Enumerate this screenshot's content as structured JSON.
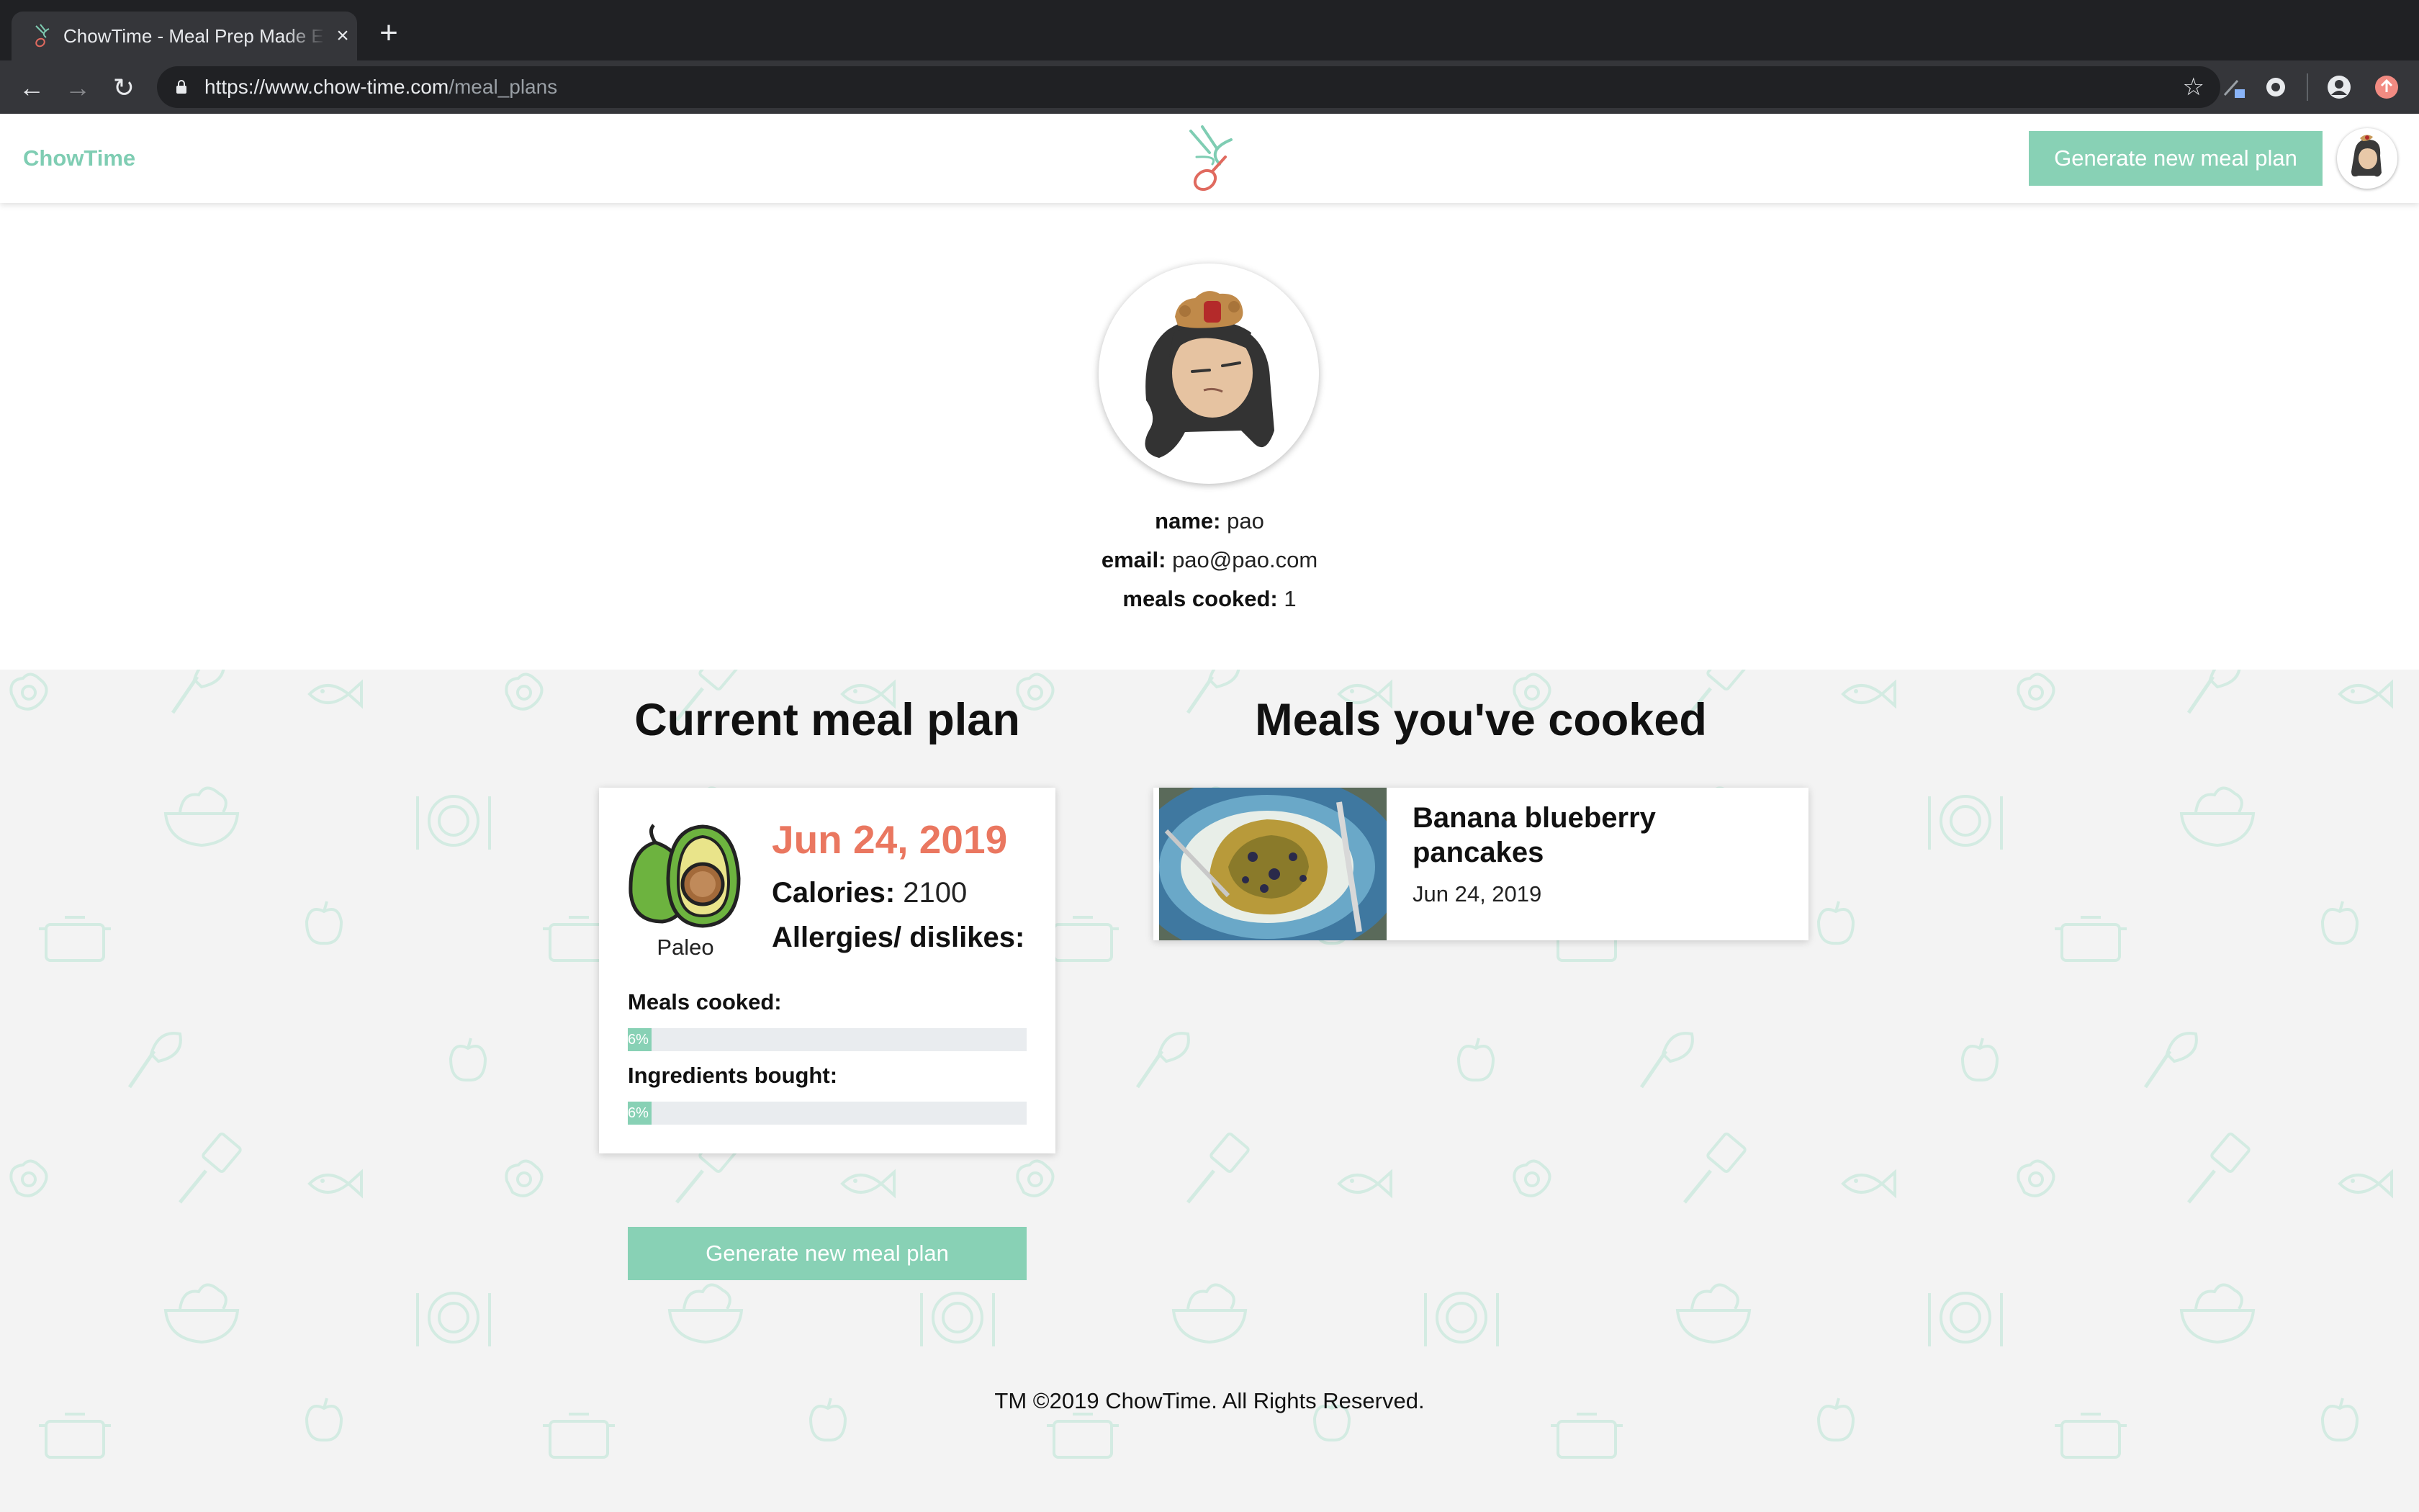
{
  "browser": {
    "tab_title": "ChowTime - Meal Prep Made E",
    "url_host": "https://www.chow-time.com",
    "url_path": "/meal_plans"
  },
  "header": {
    "brand": "ChowTime",
    "generate_button": "Generate new meal plan"
  },
  "profile": {
    "name_label": "name:",
    "name_value": " pao",
    "email_label": "email:",
    "email_value": " pao@pao.com",
    "meals_label": "meals cooked:",
    "meals_value": " 1"
  },
  "current_plan": {
    "heading": "Current meal plan",
    "diet": "Paleo",
    "date": "Jun 24, 2019",
    "calories_label": "Calories:",
    "calories_value": " 2100",
    "allergies_label": "Allergies/ dislikes:",
    "meals_cooked_label": "Meals cooked:",
    "meals_cooked_progress": 6,
    "meals_cooked_text": "6%",
    "ingredients_label": "Ingredients bought:",
    "ingredients_progress": 6,
    "ingredients_text": "6%",
    "generate_button": "Generate new meal plan"
  },
  "cooked": {
    "heading": "Meals you've cooked",
    "meals": [
      {
        "name": "Banana blueberry pancakes",
        "date": "Jun 24, 2019"
      }
    ]
  },
  "footer": {
    "text": "TM ©2019 ChowTime. All Rights Reserved."
  },
  "colors": {
    "accent": "#88d1b5",
    "brand": "#7fcdb3",
    "date": "#ea7760",
    "pattern": "#d6ede5"
  },
  "icons": [
    "chowtime-logo-icon",
    "close-icon",
    "plus-icon",
    "back-arrow-icon",
    "forward-arrow-icon",
    "reload-icon",
    "lock-icon",
    "star-icon",
    "avocado-icon"
  ]
}
